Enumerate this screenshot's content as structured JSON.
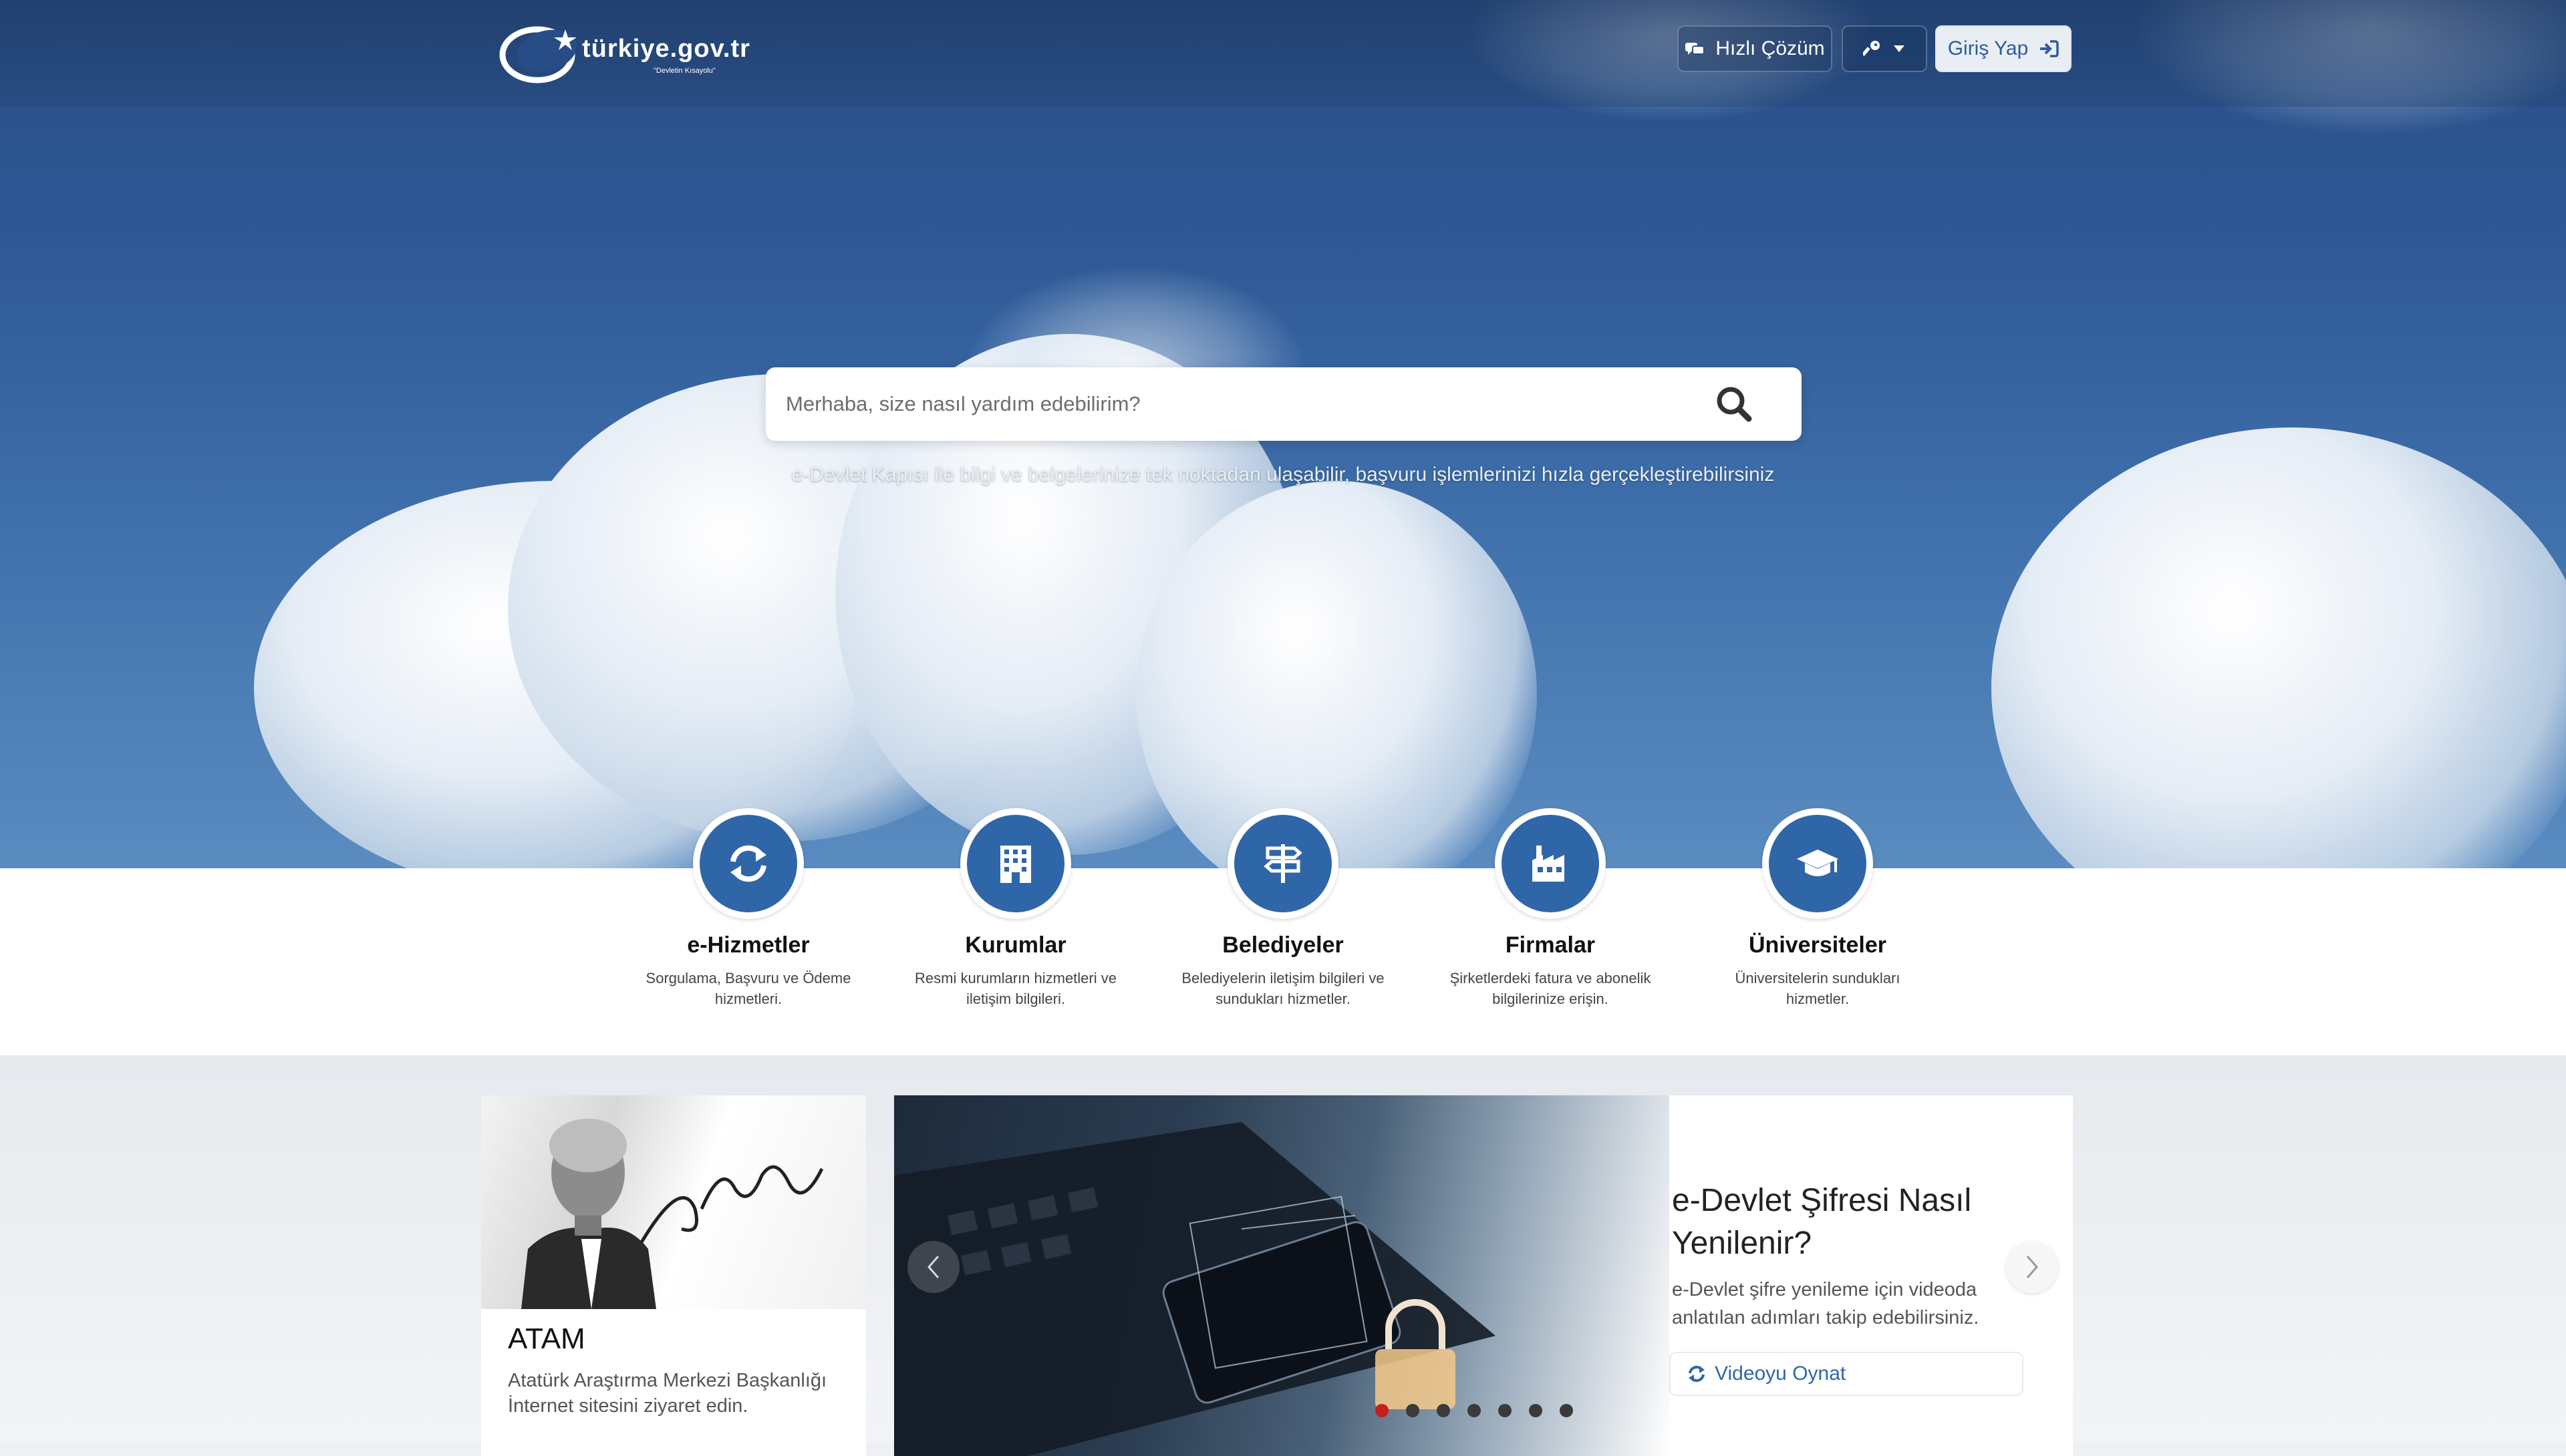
{
  "brand": {
    "name": "türkiye.gov.tr",
    "tagline": "\"Devletin Kısayolu\""
  },
  "header": {
    "hizli_cozum": "Hızlı Çözüm",
    "giris": "Giriş Yap"
  },
  "search": {
    "placeholder": "Merhaba, size nasıl yardım edebilirim?",
    "tagline": "e-Devlet Kapısı ile bilgi ve belgelerinize tek noktadan ulaşabilir, başvuru işlemlerinizi hızla gerçekleştirebilirsiniz"
  },
  "categories": [
    {
      "title": "e-Hizmetler",
      "desc": "Sorgulama, Başvuru ve Ödeme hizmetleri.",
      "icon": "refresh-icon"
    },
    {
      "title": "Kurumlar",
      "desc": "Resmi kurumların hizmetleri ve iletişim bilgileri.",
      "icon": "building-icon"
    },
    {
      "title": "Belediyeler",
      "desc": "Belediyelerin iletişim bilgileri ve sundukları hizmetler.",
      "icon": "signpost-icon"
    },
    {
      "title": "Firmalar",
      "desc": "Şirketlerdeki fatura ve abonelik bilgilerinize erişin.",
      "icon": "factory-icon"
    },
    {
      "title": "Üniversiteler",
      "desc": "Üniversitelerin sundukları hizmetler.",
      "icon": "graduation-cap-icon"
    }
  ],
  "atam": {
    "title": "ATAM",
    "desc": "Atatürk Araştırma Merkezi Başkanlığı İnternet sitesini ziyaret edin."
  },
  "slider": {
    "title": "e-Devlet Şifresi Nasıl Yenilenir?",
    "desc": "e-Devlet şifre yenileme için videoda anlatılan adımları takip edebilirsiniz.",
    "video_button": "Videoyu Oynat",
    "active_slide": 1,
    "slide_count": 7
  },
  "colors": {
    "primary": "#2f66a8",
    "accent": "#c41e1e"
  }
}
